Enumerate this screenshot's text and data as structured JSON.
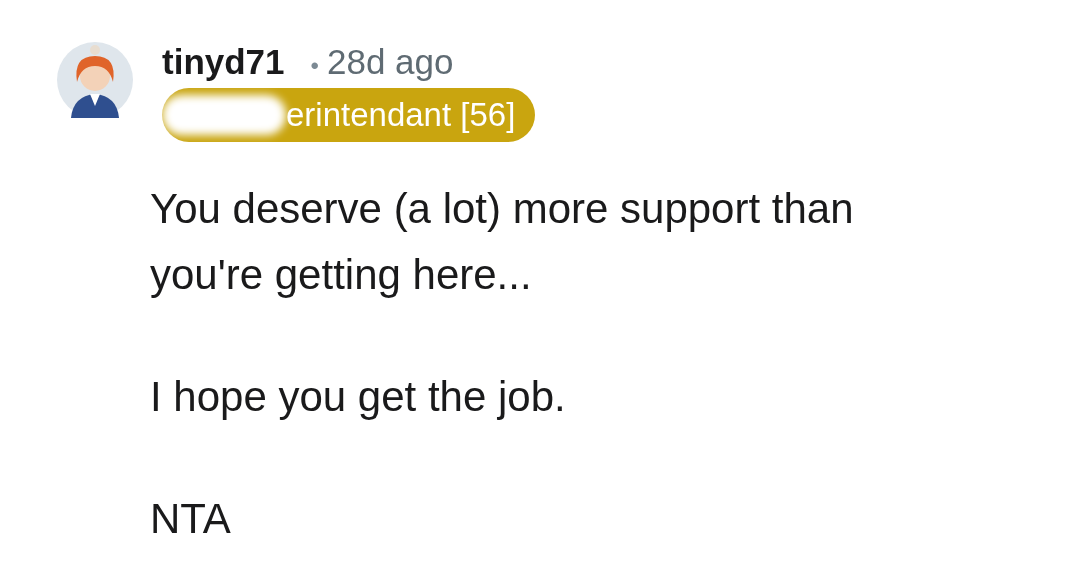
{
  "comment": {
    "username": "tinyd71",
    "separator": "•",
    "age": "28d ago",
    "flair": "erintendant [56]",
    "paragraphs": [
      "You deserve (a lot) more support than you're getting here...",
      "I hope you get the job.",
      "NTA"
    ]
  }
}
